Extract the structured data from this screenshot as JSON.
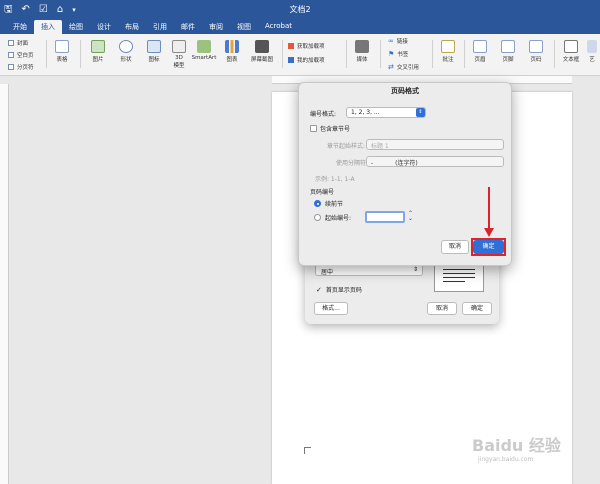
{
  "title_bar": {
    "document_title": "文档2",
    "quick_access": [
      "save-icon",
      "undo-icon",
      "redo-icon",
      "home-icon",
      "customize-icon"
    ]
  },
  "tabs": [
    "开始",
    "插入",
    "绘图",
    "设计",
    "布局",
    "引用",
    "邮件",
    "审阅",
    "视图",
    "Acrobat"
  ],
  "active_tab": "插入",
  "ribbon": {
    "pages_group": [
      "封面",
      "空白页",
      "分页符"
    ],
    "buttons": {
      "table": "表格",
      "picture": "图片",
      "shapes": "形状",
      "icons": "图标",
      "model3d_line1": "3D",
      "model3d_line2": "模型",
      "smartart": "SmartArt",
      "chart": "图表",
      "screenshot": "屏幕截图",
      "media": "媒体",
      "comment": "批注",
      "header": "页眉",
      "footer": "页脚",
      "page_number": "页码",
      "textbox": "文本框",
      "art": "艺"
    },
    "addins": [
      "获取加载项",
      "我的加载项"
    ],
    "links": [
      "链接",
      "书签",
      "交叉引用"
    ]
  },
  "page_number_dialog": {
    "alignment_value": "居中",
    "show_on_first_page_label": "首页显示页码",
    "show_on_first_page_checked": true,
    "format_button": "格式...",
    "cancel_button": "取消",
    "ok_button": "确定"
  },
  "format_dialog": {
    "title": "页码格式",
    "number_format_label": "编号格式:",
    "number_format_value": "1, 2, 3, ...",
    "include_chapter_label": "包含章节号",
    "chapter_style_label": "章节起始样式:",
    "chapter_style_value": "标题 1",
    "separator_label": "使用分隔符:",
    "separator_value": "-",
    "separator_desc": "(连字符)",
    "example_text": "示例: 1-1, 1-A",
    "numbering_label": "页码编号",
    "continue_label": "续前节",
    "start_at_label": "起始编号:",
    "start_at_value": "",
    "cancel_button": "取消",
    "ok_button": "确定"
  },
  "watermark": {
    "brand": "Baidu 经验",
    "url": "jingyan.baidu.com"
  },
  "colors": {
    "ribbon_blue": "#2b579a",
    "accent_blue": "#2f6fd6",
    "highlight_red": "#e0242b"
  }
}
